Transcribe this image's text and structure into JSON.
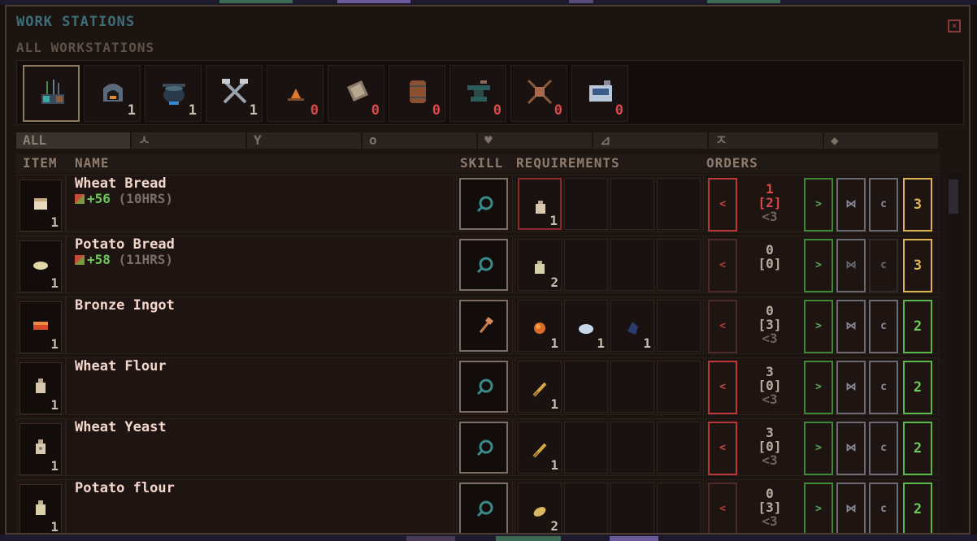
{
  "window": {
    "title": "WORK STATIONS",
    "subtitle": "ALL WORKSTATIONS",
    "close_label": "×"
  },
  "stations": [
    {
      "name": "all-workstations",
      "count": ""
    },
    {
      "name": "oven",
      "count": "1"
    },
    {
      "name": "cooking-pot",
      "count": "1"
    },
    {
      "name": "tools",
      "count": "1"
    },
    {
      "name": "campfire",
      "count": "0"
    },
    {
      "name": "saw",
      "count": "0"
    },
    {
      "name": "barrel",
      "count": "0"
    },
    {
      "name": "anvil",
      "count": "0"
    },
    {
      "name": "loom",
      "count": "0"
    },
    {
      "name": "machine",
      "count": "0"
    }
  ],
  "filters": [
    {
      "label": "ALL"
    },
    {
      "label": "ㅅ"
    },
    {
      "label": "Y"
    },
    {
      "label": "o"
    },
    {
      "label": "♥"
    },
    {
      "label": "⊿"
    },
    {
      "label": "ㅈ"
    },
    {
      "label": "◆"
    }
  ],
  "columns": {
    "item": "ITEM",
    "name": "NAME",
    "skill": "SKILL",
    "requirements": "REQUIREMENTS",
    "orders": "ORDERS"
  },
  "buttons": {
    "prev": "<",
    "next": ">",
    "repeat": "⋈",
    "clear": "c"
  },
  "rows": [
    {
      "name": "Wheat Bread",
      "qty": "1",
      "bonus": "+56",
      "hours": "(10HRS)",
      "skill": "magnifier",
      "reqs": [
        {
          "qty": "1"
        }
      ],
      "order_a": "1",
      "order_b": "[2]",
      "order_c": "<3",
      "priority": "3",
      "prio_color": "#d9b451",
      "a_color": "#d84a4a"
    },
    {
      "name": "Potato Bread",
      "qty": "1",
      "bonus": "+58",
      "hours": "(11HRS)",
      "skill": "magnifier",
      "reqs": [
        {
          "qty": "2"
        }
      ],
      "order_a": "0",
      "order_b": "[0]",
      "order_c": "",
      "priority": "3",
      "prio_color": "#d9b451",
      "a_color": "#b8ada2"
    },
    {
      "name": "Bronze Ingot",
      "qty": "1",
      "bonus": "",
      "hours": "",
      "skill": "hammer",
      "reqs": [
        {
          "qty": "1"
        },
        {
          "qty": "1"
        },
        {
          "qty": "1"
        }
      ],
      "order_a": "0",
      "order_b": "[3]",
      "order_c": "<3",
      "priority": "2",
      "prio_color": "#6fc85a",
      "a_color": "#b8ada2"
    },
    {
      "name": "Wheat Flour",
      "qty": "1",
      "bonus": "",
      "hours": "",
      "skill": "magnifier",
      "reqs": [
        {
          "qty": "1"
        }
      ],
      "order_a": "3",
      "order_b": "[0]",
      "order_c": "<3",
      "priority": "2",
      "prio_color": "#6fc85a",
      "a_color": "#b8ada2"
    },
    {
      "name": "Wheat Yeast",
      "qty": "1",
      "bonus": "",
      "hours": "",
      "skill": "magnifier",
      "reqs": [
        {
          "qty": "1"
        }
      ],
      "order_a": "3",
      "order_b": "[0]",
      "order_c": "<3",
      "priority": "2",
      "prio_color": "#6fc85a",
      "a_color": "#b8ada2"
    },
    {
      "name": "Potato flour",
      "qty": "1",
      "bonus": "",
      "hours": "",
      "skill": "magnifier",
      "reqs": [
        {
          "qty": "2"
        }
      ],
      "order_a": "0",
      "order_b": "[3]",
      "order_c": "<3",
      "priority": "2",
      "prio_color": "#6fc85a",
      "a_color": "#b8ada2"
    }
  ]
}
